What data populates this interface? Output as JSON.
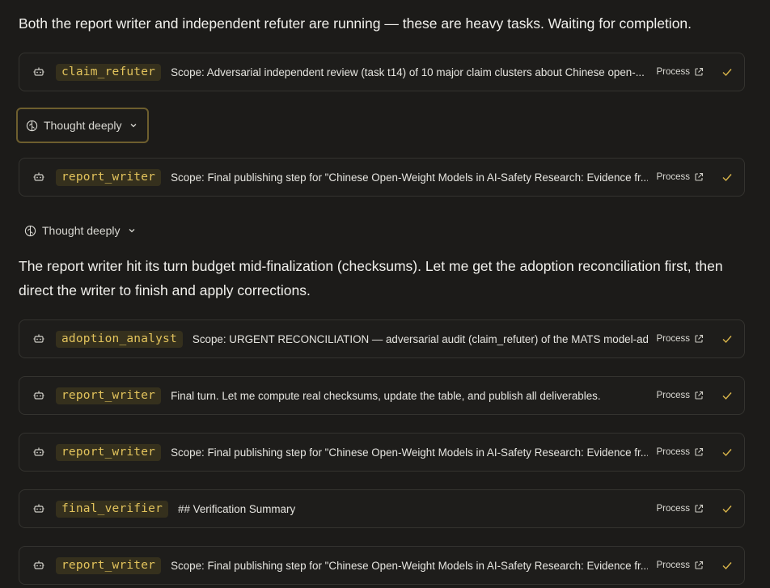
{
  "messages": [
    "Both the report writer and independent refuter are running — these are heavy tasks. Waiting for completion.",
    "The report writer hit its turn budget mid-finalization (checksums). Let me get the adoption reconciliation first, then direct the writer to finish and apply corrections."
  ],
  "thought_label": "Thought deeply",
  "process_label": "Process",
  "cards": [
    {
      "agent": "claim_refuter",
      "scope": "Scope: Adversarial independent review (task t14) of 10 major claim clusters about Chinese open-..."
    },
    {
      "agent": "report_writer",
      "scope": "Scope: Final publishing step for \"Chinese Open-Weight Models in AI-Safety Research: Evidence fr..."
    },
    {
      "agent": "adoption_analyst",
      "scope": "Scope: URGENT RECONCILIATION — adversarial audit (claim_refuter) of the MATS model-ad..."
    },
    {
      "agent": "report_writer",
      "scope": "Final turn. Let me compute real checksums, update the table, and publish all deliverables."
    },
    {
      "agent": "report_writer",
      "scope": "Scope: Final publishing step for \"Chinese Open-Weight Models in AI-Safety Research: Evidence fr..."
    },
    {
      "agent": "final_verifier",
      "scope": "## Verification Summary"
    },
    {
      "agent": "report_writer",
      "scope": "Scope: Final publishing step for \"Chinese Open-Weight Models in AI-Safety Research: Evidence fr..."
    }
  ],
  "icons": {
    "agent": "robot-icon",
    "thought": "brain-icon",
    "expand": "chevron-down-icon",
    "external": "external-link-icon",
    "status": "check-icon"
  },
  "colors": {
    "background": "#1c1b19",
    "agent_text": "#e2c35c",
    "agent_bg": "#35301d",
    "check": "#d9b54a",
    "focus_border": "#6d5e2e"
  }
}
